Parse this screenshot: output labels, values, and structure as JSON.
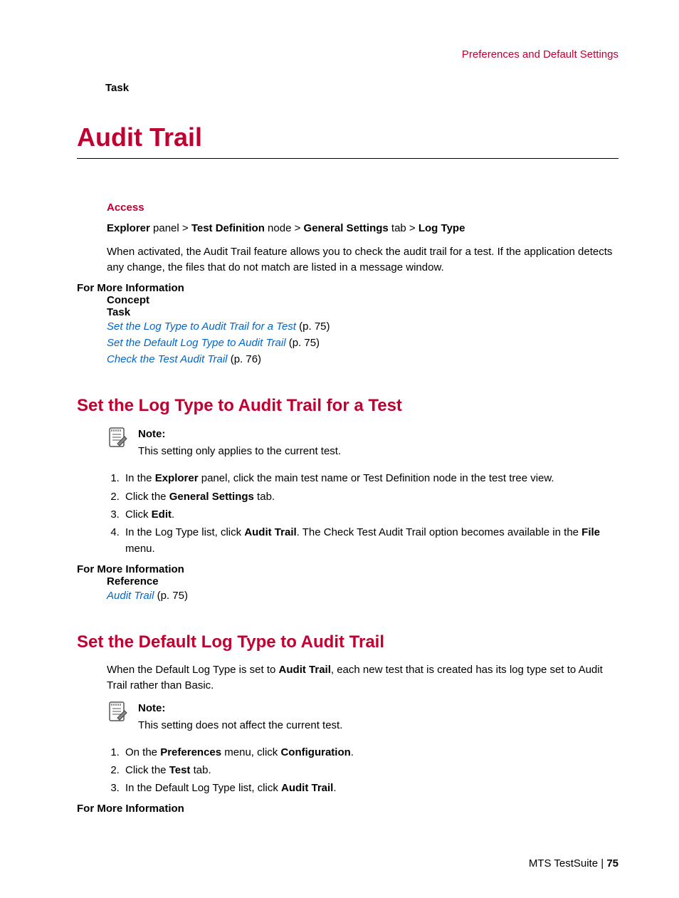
{
  "header": {
    "breadcrumb": "Preferences and Default Settings",
    "task": "Task"
  },
  "title": "Audit Trail",
  "access": {
    "label": "Access",
    "path": {
      "p1": "Explorer",
      "t1": " panel > ",
      "p2": "Test Definition",
      "t2": " node > ",
      "p3": "General Settings",
      "t3": " tab > ",
      "p4": "Log Type"
    },
    "desc": "When activated, the Audit Trail feature allows you to check the audit trail for a test. If the application detects any change, the files that do not match are listed in a message window."
  },
  "fmi1": {
    "title": "For More Information",
    "concept": "Concept",
    "task": "Task",
    "links": [
      {
        "text": "Set the Log Type to Audit Trail for a Test",
        "page": "(p. 75)"
      },
      {
        "text": "Set the Default Log Type to Audit Trail",
        "page": "(p. 75)"
      },
      {
        "text": "Check the Test Audit Trail",
        "page": "(p. 76)"
      }
    ]
  },
  "section1": {
    "title": "Set the Log Type to Audit Trail for a Test",
    "note_label": "Note:",
    "note_text": "This setting only applies to the current test.",
    "steps": {
      "s1a": "In the ",
      "s1b": "Explorer",
      "s1c": " panel, click the main test name or Test Definition node in the test tree view.",
      "s2a": "Click the ",
      "s2b": "General Settings",
      "s2c": " tab.",
      "s3a": "Click ",
      "s3b": "Edit",
      "s3c": ".",
      "s4a": "In the Log Type list, click ",
      "s4b": "Audit Trail",
      "s4c": ". The Check Test Audit Trail option becomes available in the ",
      "s4d": "File",
      "s4e": " menu."
    },
    "fmi": "For More Information",
    "ref": "Reference",
    "link_text": "Audit Trail",
    "link_page": "(p. 75)"
  },
  "section2": {
    "title": "Set the Default Log Type to Audit Trail",
    "intro_a": "When the Default Log Type is set to ",
    "intro_b": "Audit Trail",
    "intro_c": ", each new test that is created has its log type set to Audit Trail rather than Basic.",
    "note_label": "Note:",
    "note_text": "This setting does not affect the current test.",
    "steps": {
      "s1a": "On the ",
      "s1b": "Preferences",
      "s1c": " menu, click ",
      "s1d": "Configuration",
      "s1e": ".",
      "s2a": "Click the ",
      "s2b": "Test",
      "s2c": " tab.",
      "s3a": "In the Default Log Type list, click ",
      "s3b": "Audit Trail",
      "s3c": "."
    },
    "fmi": "For More Information"
  },
  "footer": {
    "product": "MTS TestSuite | ",
    "page": "75"
  }
}
